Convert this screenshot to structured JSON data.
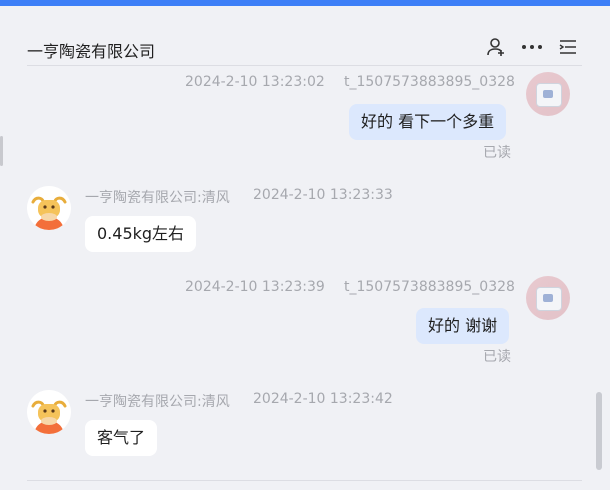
{
  "window": {
    "title": "一亨陶瓷有限公司"
  },
  "header_icons": [
    "user-add-icon",
    "more-horizontal-icon",
    "list-menu-icon"
  ],
  "messages": [
    {
      "direction": "out",
      "time": "2024-2-10 13:23:02",
      "sender": "t_1507573883895_0328",
      "text": "好的 看下一个多重",
      "status": "已读"
    },
    {
      "direction": "in",
      "sender": "一亨陶瓷有限公司:清风",
      "time": "2024-2-10 13:23:33",
      "text": "0.45kg左右"
    },
    {
      "direction": "out",
      "time": "2024-2-10 13:23:39",
      "sender": "t_1507573883895_0328",
      "text": "好的 谢谢",
      "status": "已读"
    },
    {
      "direction": "in",
      "sender": "一亨陶瓷有限公司:清风",
      "time": "2024-2-10 13:23:42",
      "text": "客气了"
    }
  ],
  "colors": {
    "accent": "#3d7ff7",
    "bubble_out": "#dce8fd",
    "bubble_in": "#ffffff",
    "background": "#f0f1f5"
  }
}
